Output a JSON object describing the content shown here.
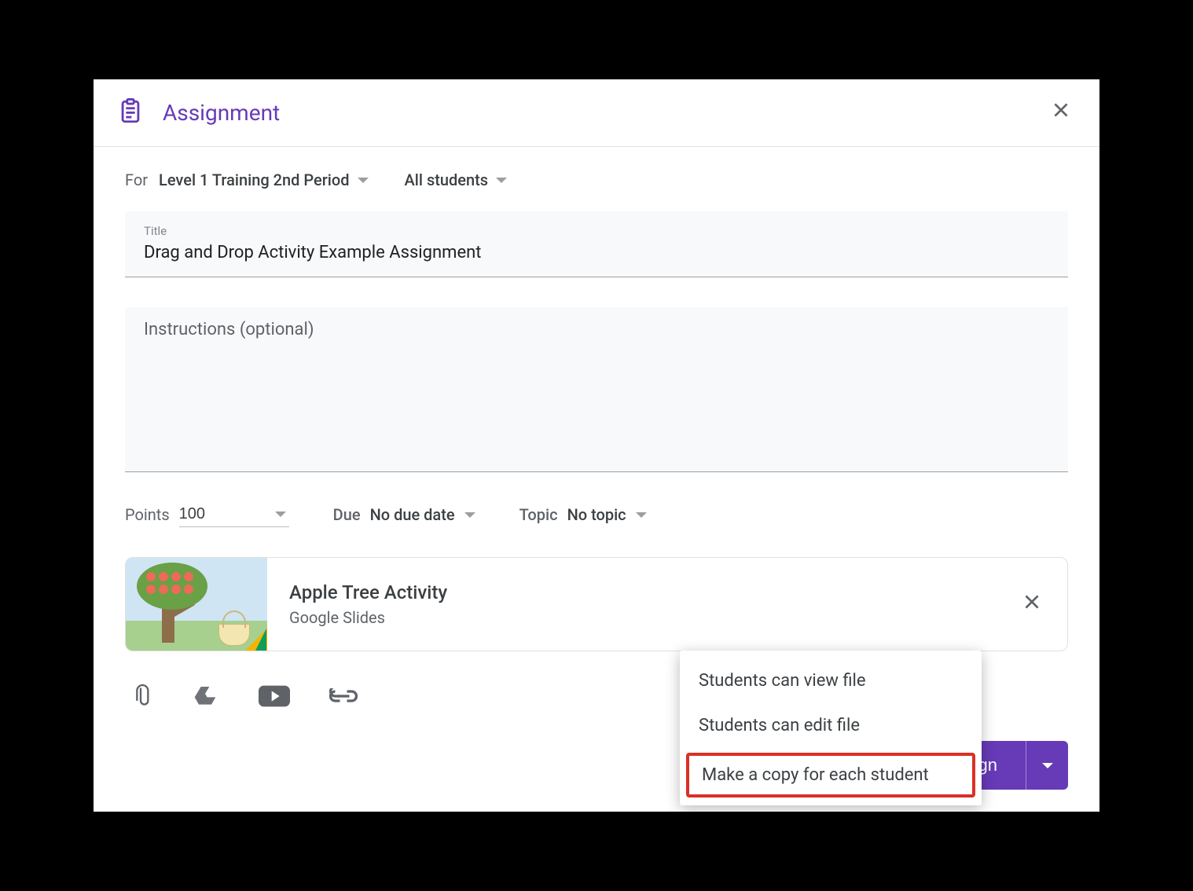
{
  "header": {
    "title": "Assignment"
  },
  "for": {
    "label": "For",
    "class": "Level 1 Training 2nd Period",
    "students": "All students"
  },
  "title_field": {
    "label": "Title",
    "value": "Drag and Drop Activity Example Assignment"
  },
  "instructions": {
    "placeholder": "Instructions (optional)"
  },
  "points": {
    "label": "Points",
    "value": "100"
  },
  "due": {
    "label": "Due",
    "value": "No due date"
  },
  "topic": {
    "label": "Topic",
    "value": "No topic"
  },
  "attachment": {
    "title": "Apple Tree Activity",
    "type": "Google Slides"
  },
  "menu": {
    "view": "Students can view file",
    "edit": "Students can edit file",
    "copy": "Make a copy for each student"
  },
  "assign": {
    "label": "Assign"
  }
}
